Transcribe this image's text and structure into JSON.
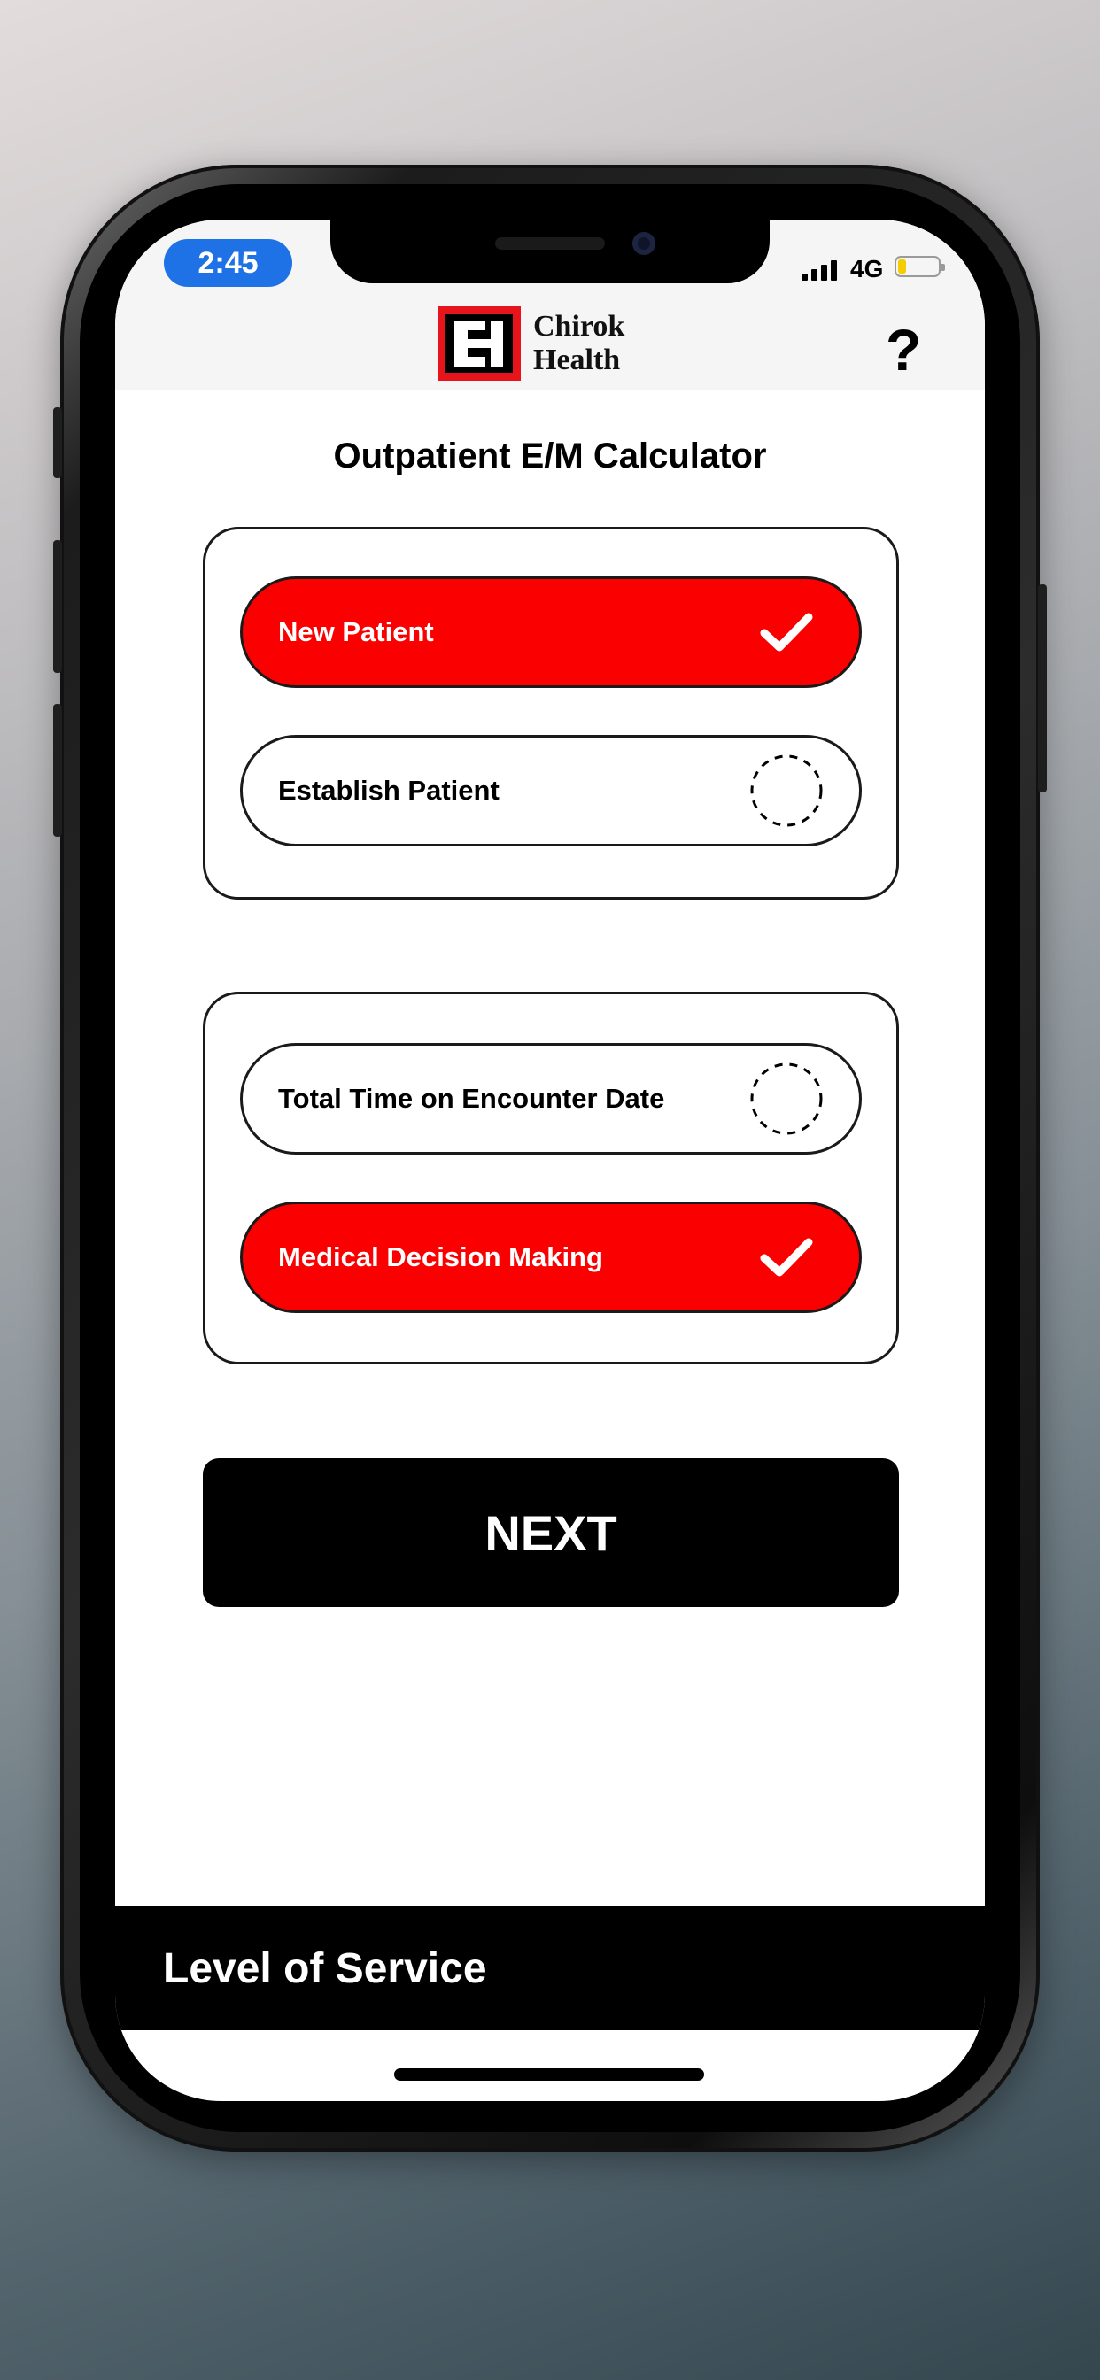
{
  "status_bar": {
    "time": "2:45",
    "network": "4G",
    "battery_level": 0.2,
    "icons": [
      "signal-icon",
      "battery-icon"
    ]
  },
  "header": {
    "logo_line1": "Chirok",
    "logo_line2": "Health",
    "help_label": "?"
  },
  "main": {
    "title": "Outpatient E/M Calculator",
    "patient_type": {
      "options": [
        {
          "label": "New Patient",
          "selected": true
        },
        {
          "label": "Establish Patient",
          "selected": false
        }
      ]
    },
    "basis": {
      "options": [
        {
          "label": "Total Time on Encounter Date",
          "selected": false
        },
        {
          "label": "Medical Decision Making",
          "selected": true
        }
      ]
    },
    "next_label": "NEXT"
  },
  "footer": {
    "label": "Level of Service"
  },
  "colors": {
    "accent": "#fa0000",
    "time_pill": "#1f72e6",
    "primary_button": "#000000"
  }
}
